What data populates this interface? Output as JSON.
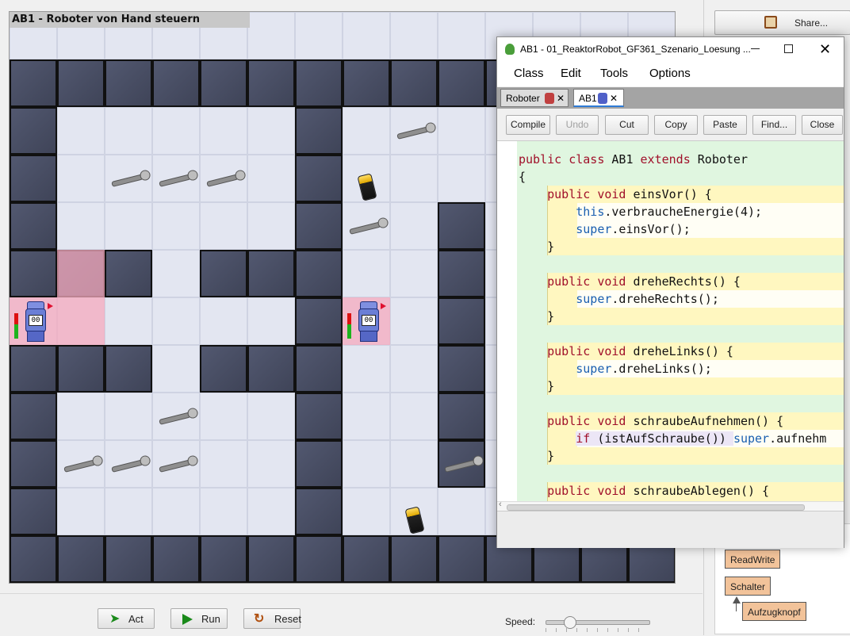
{
  "world": {
    "title": "AB1 - Roboter von Hand steuern"
  },
  "controls": {
    "act_label": "Act",
    "run_label": "Run",
    "reset_label": "Reset",
    "speed_label": "Speed:",
    "speed_level": 0.2
  },
  "share": {
    "label": "Share..."
  },
  "classes": {
    "readwrite": "ReadWrite",
    "schalter": "Schalter",
    "aufzugknopf": "Aufzugknopf"
  },
  "editor": {
    "title": "AB1 - 01_ReaktorRobot_GF361_Szenario_Loesung ...",
    "menu": [
      "Class",
      "Edit",
      "Tools",
      "Options"
    ],
    "tabs": [
      {
        "label": "Roboter"
      },
      {
        "label": "AB1"
      }
    ],
    "toolbar": {
      "compile": "Compile",
      "undo": "Undo",
      "cut": "Cut",
      "copy": "Copy",
      "paste": "Paste",
      "find": "Find...",
      "close": "Close"
    },
    "code": [
      "public class AB1 extends Roboter",
      "{",
      "    public void einsVor() {",
      "        this.verbraucheEnergie(4);",
      "        super.einsVor();",
      "    }",
      "",
      "    public void dreheRechts() {",
      "        super.dreheRechts();",
      "    }",
      "",
      "    public void dreheLinks() {",
      "        super.dreheLinks();",
      "    }",
      "",
      "    public void schraubeAufnehmen() {",
      "        if (istAufSchraube()) super.aufnehm",
      "    }",
      "",
      "    public void schraubeAblegen() {"
    ]
  },
  "robots": [
    {
      "face": "00",
      "energy": 0.7
    },
    {
      "face": "00",
      "energy": 0.7
    }
  ]
}
